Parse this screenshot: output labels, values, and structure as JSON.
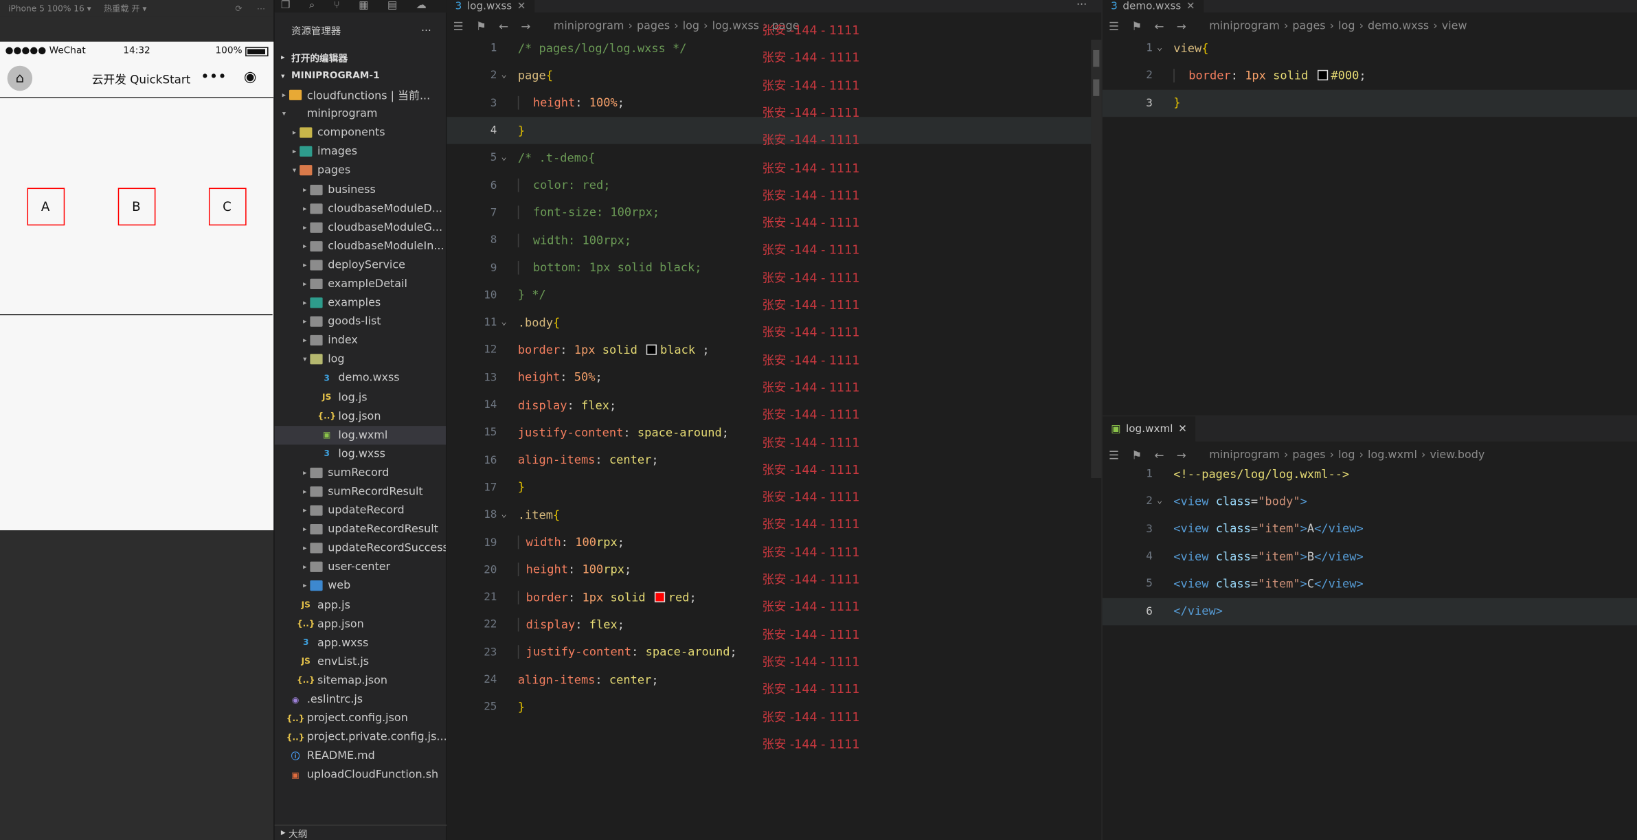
{
  "simulator": {
    "device_label": "iPhone 5 100% 16 ▾",
    "hot_reload": "热重载 开 ▾",
    "status": {
      "carrier": "●●●●● WeChat",
      "time": "14:32",
      "battery": "100%"
    },
    "nav_title": "云开发 QuickStart",
    "capsule_more": "•••",
    "items": [
      "A",
      "B",
      "C"
    ]
  },
  "explorer": {
    "title": "资源管理器",
    "open_editors": "打开的编辑器",
    "project": "MINIPROGRAM-1",
    "tree": [
      {
        "label": "cloudfunctions | 当前...",
        "icon": "fi-cloud",
        "level": 0,
        "twisty": "▸"
      },
      {
        "label": "miniprogram",
        "icon": "",
        "level": 0,
        "twisty": "▾"
      },
      {
        "label": "components",
        "icon": "fi-comp",
        "level": 1,
        "twisty": "▸"
      },
      {
        "label": "images",
        "icon": "fi-img",
        "level": 1,
        "twisty": "▸"
      },
      {
        "label": "pages",
        "icon": "fi-pages",
        "level": 1,
        "twisty": "▾"
      },
      {
        "label": "business",
        "icon": "fi-folder",
        "level": 2,
        "twisty": "▸"
      },
      {
        "label": "cloudbaseModuleD...",
        "icon": "fi-folder",
        "level": 2,
        "twisty": "▸"
      },
      {
        "label": "cloudbaseModuleG...",
        "icon": "fi-folder",
        "level": 2,
        "twisty": "▸"
      },
      {
        "label": "cloudbaseModuleIn...",
        "icon": "fi-folder",
        "level": 2,
        "twisty": "▸"
      },
      {
        "label": "deployService",
        "icon": "fi-folder",
        "level": 2,
        "twisty": "▸"
      },
      {
        "label": "exampleDetail",
        "icon": "fi-folder",
        "level": 2,
        "twisty": "▸"
      },
      {
        "label": "examples",
        "icon": "fi-img",
        "level": 2,
        "twisty": "▸"
      },
      {
        "label": "goods-list",
        "icon": "fi-folder",
        "level": 2,
        "twisty": "▸"
      },
      {
        "label": "index",
        "icon": "fi-folder",
        "level": 2,
        "twisty": "▸"
      },
      {
        "label": "log",
        "icon": "fi-log",
        "level": 2,
        "twisty": "▾"
      },
      {
        "label": "demo.wxss",
        "icon": "fi-css",
        "glyph": "3",
        "level": 3,
        "twisty": ""
      },
      {
        "label": "log.js",
        "icon": "fi-js",
        "glyph": "JS",
        "level": 3,
        "twisty": ""
      },
      {
        "label": "log.json",
        "icon": "fi-json",
        "glyph": "{..}",
        "level": 3,
        "twisty": ""
      },
      {
        "label": "log.wxml",
        "icon": "fi-wxml",
        "glyph": "▣",
        "level": 3,
        "twisty": "",
        "selected": true
      },
      {
        "label": "log.wxss",
        "icon": "fi-css",
        "glyph": "3",
        "level": 3,
        "twisty": ""
      },
      {
        "label": "sumRecord",
        "icon": "fi-folder",
        "level": 2,
        "twisty": "▸"
      },
      {
        "label": "sumRecordResult",
        "icon": "fi-folder",
        "level": 2,
        "twisty": "▸"
      },
      {
        "label": "updateRecord",
        "icon": "fi-folder",
        "level": 2,
        "twisty": "▸"
      },
      {
        "label": "updateRecordResult",
        "icon": "fi-folder",
        "level": 2,
        "twisty": "▸"
      },
      {
        "label": "updateRecordSuccess",
        "icon": "fi-folder",
        "level": 2,
        "twisty": "▸"
      },
      {
        "label": "user-center",
        "icon": "fi-folder",
        "level": 2,
        "twisty": "▸"
      },
      {
        "label": "web",
        "icon": "fi-web",
        "level": 2,
        "twisty": "▸"
      },
      {
        "label": "app.js",
        "icon": "fi-js",
        "glyph": "JS",
        "level": 1,
        "twisty": ""
      },
      {
        "label": "app.json",
        "icon": "fi-json",
        "glyph": "{..}",
        "level": 1,
        "twisty": ""
      },
      {
        "label": "app.wxss",
        "icon": "fi-css",
        "glyph": "3",
        "level": 1,
        "twisty": ""
      },
      {
        "label": "envList.js",
        "icon": "fi-js",
        "glyph": "JS",
        "level": 1,
        "twisty": ""
      },
      {
        "label": "sitemap.json",
        "icon": "fi-json",
        "glyph": "{..}",
        "level": 1,
        "twisty": ""
      },
      {
        "label": ".eslintrc.js",
        "icon": "fi-lint",
        "glyph": "◉",
        "level": 0,
        "twisty": ""
      },
      {
        "label": "project.config.json",
        "icon": "fi-json",
        "glyph": "{..}",
        "level": 0,
        "twisty": ""
      },
      {
        "label": "project.private.config.js...",
        "icon": "fi-json",
        "glyph": "{..}",
        "level": 0,
        "twisty": ""
      },
      {
        "label": "README.md",
        "icon": "fi-md",
        "glyph": "ⓘ",
        "level": 0,
        "twisty": ""
      },
      {
        "label": "uploadCloudFunction.sh",
        "icon": "fi-sh",
        "glyph": "▣",
        "level": 0,
        "twisty": ""
      }
    ],
    "outline": "大纲"
  },
  "editor_main": {
    "tab": "log.wxss",
    "breadcrumb": [
      "miniprogram",
      "pages",
      "log",
      "log.wxss",
      "page"
    ],
    "ghost_text": "张安 -144 - 1111",
    "ghost_rows": 27,
    "lines": [
      [
        [
          "c-com",
          "/* pages/log/log.wxss */"
        ]
      ],
      [
        [
          "c-sel",
          "page"
        ],
        [
          "c-br",
          "{"
        ]
      ],
      [
        [
          "i",
          ""
        ],
        [
          "c-prop",
          "height"
        ],
        [
          "c-punc",
          ": "
        ],
        [
          "c-num",
          "100%"
        ],
        [
          "c-punc",
          ";"
        ]
      ],
      [
        [
          "c-br",
          "}"
        ]
      ],
      [
        [
          "c-com",
          "/* .t-demo{"
        ]
      ],
      [
        [
          "i",
          ""
        ],
        [
          "c-com",
          "color: red;"
        ]
      ],
      [
        [
          "i",
          ""
        ],
        [
          "c-com",
          "font-size: 100rpx;"
        ]
      ],
      [
        [
          "i",
          ""
        ],
        [
          "c-com",
          "width: 100rpx;"
        ]
      ],
      [
        [
          "i",
          ""
        ],
        [
          "c-com",
          "bottom: 1px solid black;"
        ]
      ],
      [
        [
          "c-com",
          "} */"
        ]
      ],
      [
        [
          "c-sel",
          ".body"
        ],
        [
          "c-br",
          "{"
        ]
      ],
      [
        [
          "c-prop",
          "border"
        ],
        [
          "c-punc",
          ": "
        ],
        [
          "c-num",
          "1px"
        ],
        [
          "c-val",
          " solid "
        ],
        [
          "sw",
          "#000000"
        ],
        [
          "c-val",
          "black"
        ],
        [
          "c-punc",
          " ;"
        ]
      ],
      [
        [
          "c-prop",
          "height"
        ],
        [
          "c-punc",
          ": "
        ],
        [
          "c-num",
          "50%"
        ],
        [
          "c-punc",
          ";"
        ]
      ],
      [
        [
          "c-prop",
          "display"
        ],
        [
          "c-punc",
          ": "
        ],
        [
          "c-val",
          "flex"
        ],
        [
          "c-punc",
          ";"
        ]
      ],
      [
        [
          "c-prop",
          "justify-content"
        ],
        [
          "c-punc",
          ": "
        ],
        [
          "c-val",
          "space-around"
        ],
        [
          "c-punc",
          ";"
        ]
      ],
      [
        [
          "c-prop",
          "align-items"
        ],
        [
          "c-punc",
          ": "
        ],
        [
          "c-val",
          "center"
        ],
        [
          "c-punc",
          ";"
        ]
      ],
      [
        [
          "c-br",
          "}"
        ]
      ],
      [
        [
          "c-sel",
          ".item"
        ],
        [
          "c-br",
          "{"
        ]
      ],
      [
        [
          "j",
          ""
        ],
        [
          "c-prop",
          "width"
        ],
        [
          "c-punc",
          ": "
        ],
        [
          "c-num",
          "100"
        ],
        [
          "c-val",
          "rpx"
        ],
        [
          "c-punc",
          ";"
        ]
      ],
      [
        [
          "j",
          ""
        ],
        [
          "c-prop",
          "height"
        ],
        [
          "c-punc",
          ": "
        ],
        [
          "c-num",
          "100"
        ],
        [
          "c-val",
          "rpx"
        ],
        [
          "c-punc",
          ";"
        ]
      ],
      [
        [
          "j",
          ""
        ],
        [
          "c-prop",
          "border"
        ],
        [
          "c-punc",
          ": "
        ],
        [
          "c-num",
          "1px"
        ],
        [
          "c-val",
          " solid "
        ],
        [
          "sw",
          "#ff0000"
        ],
        [
          "c-val",
          "red"
        ],
        [
          "c-punc",
          ";"
        ]
      ],
      [
        [
          "j",
          ""
        ],
        [
          "c-prop",
          "display"
        ],
        [
          "c-punc",
          ": "
        ],
        [
          "c-val",
          "flex"
        ],
        [
          "c-punc",
          ";"
        ]
      ],
      [
        [
          "j",
          ""
        ],
        [
          "c-prop",
          "justify-content"
        ],
        [
          "c-punc",
          ": "
        ],
        [
          "c-val",
          "space-around"
        ],
        [
          "c-punc",
          ";"
        ]
      ],
      [
        [
          "c-prop",
          "align-items"
        ],
        [
          "c-punc",
          ": "
        ],
        [
          "c-val",
          "center"
        ],
        [
          "c-punc",
          ";"
        ]
      ],
      [
        [
          "c-br",
          "}"
        ]
      ]
    ],
    "current_line": 4,
    "folds": [
      2,
      5,
      11,
      18
    ]
  },
  "editor_demo": {
    "tab": "demo.wxss",
    "breadcrumb": [
      "miniprogram",
      "pages",
      "log",
      "demo.wxss",
      "view"
    ],
    "lines": [
      [
        [
          "c-sel",
          "view"
        ],
        [
          "c-br",
          "{"
        ]
      ],
      [
        [
          "i",
          ""
        ],
        [
          "c-prop",
          "border"
        ],
        [
          "c-punc",
          ": "
        ],
        [
          "c-num",
          "1px"
        ],
        [
          "c-val",
          " solid "
        ],
        [
          "sw",
          "#000000"
        ],
        [
          "c-val",
          "#000"
        ],
        [
          "c-punc",
          ";"
        ]
      ],
      [
        [
          "c-br",
          "}"
        ]
      ]
    ],
    "current_line": 3,
    "folds": [
      1
    ]
  },
  "editor_wxml": {
    "tab": "log.wxml",
    "breadcrumb": [
      "miniprogram",
      "pages",
      "log",
      "log.wxml",
      "view.body"
    ],
    "lines": [
      [
        [
          "c-val",
          "<!--pages/log/log.wxml-->"
        ]
      ],
      [
        [
          "c-tag",
          "<view "
        ],
        [
          "c-attr",
          "class"
        ],
        [
          "c-punc",
          "="
        ],
        [
          "c-str",
          "\"body\""
        ],
        [
          "c-tag",
          ">"
        ]
      ],
      [
        [
          "c-tag",
          "<view "
        ],
        [
          "c-attr",
          "class"
        ],
        [
          "c-punc",
          "="
        ],
        [
          "c-str",
          "\"item\""
        ],
        [
          "c-tag",
          ">"
        ],
        [
          "c-punc",
          "A"
        ],
        [
          "c-tag",
          "</view>"
        ]
      ],
      [
        [
          "c-tag",
          "<view "
        ],
        [
          "c-attr",
          "class"
        ],
        [
          "c-punc",
          "="
        ],
        [
          "c-str",
          "\"item\""
        ],
        [
          "c-tag",
          ">"
        ],
        [
          "c-punc",
          "B"
        ],
        [
          "c-tag",
          "</view>"
        ]
      ],
      [
        [
          "c-tag",
          "<view "
        ],
        [
          "c-attr",
          "class"
        ],
        [
          "c-punc",
          "="
        ],
        [
          "c-str",
          "\"item\""
        ],
        [
          "c-tag",
          ">"
        ],
        [
          "c-punc",
          "C"
        ],
        [
          "c-tag",
          "</view>"
        ]
      ],
      [
        [
          "c-tag",
          "</view>"
        ]
      ]
    ],
    "current_line": 6,
    "folds": [
      2
    ]
  }
}
